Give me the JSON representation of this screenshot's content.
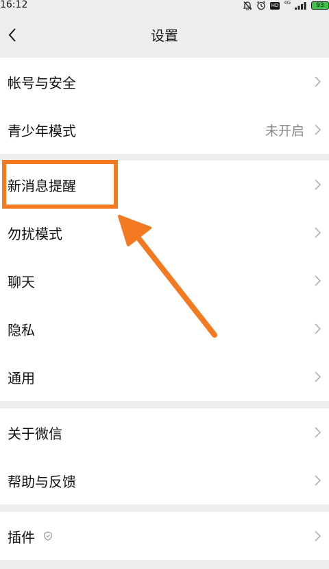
{
  "status_bar": {
    "time": "16:12",
    "network": "4G",
    "hd": "HD",
    "battery": "93"
  },
  "nav": {
    "title": "设置"
  },
  "groups": [
    {
      "items": [
        {
          "label": "帐号与安全",
          "value": ""
        },
        {
          "label": "青少年模式",
          "value": "未开启"
        }
      ]
    },
    {
      "items": [
        {
          "label": "新消息提醒",
          "value": ""
        },
        {
          "label": "勿扰模式",
          "value": ""
        },
        {
          "label": "聊天",
          "value": ""
        },
        {
          "label": "隐私",
          "value": ""
        },
        {
          "label": "通用",
          "value": ""
        }
      ]
    },
    {
      "items": [
        {
          "label": "关于微信",
          "value": ""
        },
        {
          "label": "帮助与反馈",
          "value": ""
        }
      ]
    },
    {
      "items": [
        {
          "label": "插件",
          "value": ""
        }
      ]
    }
  ],
  "annotation": {
    "color": "#f47a22"
  }
}
